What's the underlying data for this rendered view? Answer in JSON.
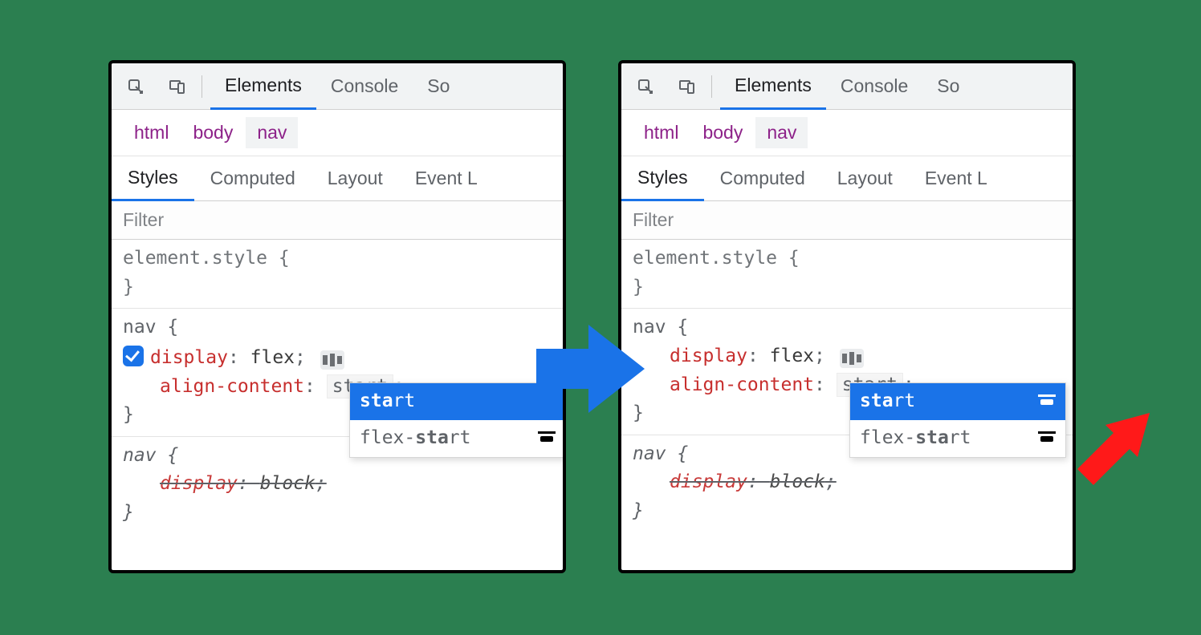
{
  "toolbar": {
    "tabs": [
      "Elements",
      "Console",
      "So"
    ],
    "active": 0
  },
  "breadcrumb": [
    "html",
    "body",
    "nav"
  ],
  "breadcrumb_selected": 2,
  "subtabs": [
    "Styles",
    "Computed",
    "Layout",
    "Event L"
  ],
  "subtab_active": 0,
  "filter_placeholder": "Filter",
  "element_style": {
    "selector": "element.style",
    "open": "{",
    "close": "}"
  },
  "nav_rule": {
    "selector": "nav",
    "open": "{",
    "prop1": "display",
    "val1": "flex",
    "prop2": "align-content",
    "val2": "start",
    "close": "}"
  },
  "ua_rule": {
    "selector": "nav",
    "open": "{",
    "prop": "display",
    "val": "block",
    "close": "}"
  },
  "autocomplete": {
    "typed_bold": "sta",
    "typed_rest": "rt",
    "options": [
      {
        "text_bold": "sta",
        "text_rest": "rt",
        "has_icon_left": false,
        "has_icon_right": true,
        "selected": true,
        "value": "start"
      },
      {
        "text_pre": "flex-",
        "text_bold": "sta",
        "text_rest": "rt",
        "has_icon_left": false,
        "has_icon_right": true,
        "selected": false,
        "value": "flex-start"
      }
    ]
  },
  "left_panel": {
    "shows_icons": false,
    "shows_checkbox": true
  },
  "right_panel": {
    "shows_icons": true,
    "shows_checkbox": false
  }
}
